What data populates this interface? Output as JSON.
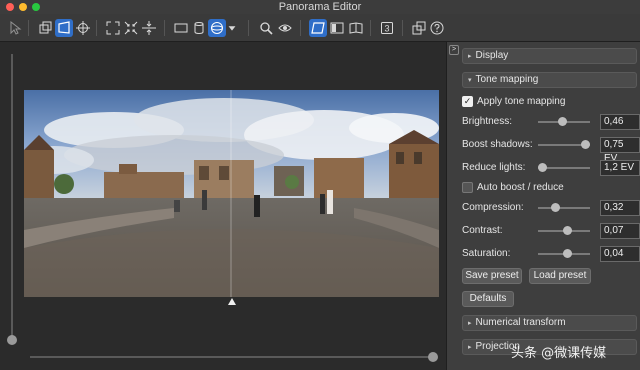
{
  "window": {
    "title": "Panorama Editor"
  },
  "toolbar": {
    "tools": [
      {
        "icon": "pointer-icon",
        "active": false
      },
      {
        "icon": "crop-icon",
        "active": false
      },
      {
        "icon": "projection-icon",
        "active": true
      },
      {
        "icon": "crosshair-icon",
        "active": false
      },
      {
        "icon": "fit-icon",
        "active": false
      },
      {
        "icon": "shrink-icon",
        "active": false
      },
      {
        "icon": "align-icon",
        "active": false
      },
      {
        "icon": "rectangle-icon",
        "active": false
      },
      {
        "icon": "cylinder-icon",
        "active": false
      },
      {
        "icon": "sphere-icon",
        "active": true
      },
      {
        "icon": "dropdown-arrow-icon",
        "active": false
      },
      {
        "icon": "zoom-icon",
        "active": false
      },
      {
        "icon": "eye-icon",
        "active": false
      },
      {
        "icon": "view-flat-icon",
        "active": true
      },
      {
        "icon": "view-tilt-icon",
        "active": false
      },
      {
        "icon": "view-book-icon",
        "active": false
      },
      {
        "icon": "three-icon",
        "active": false,
        "text": "3"
      },
      {
        "icon": "export-icon",
        "active": false
      },
      {
        "icon": "help-icon",
        "active": false
      }
    ]
  },
  "panel": {
    "collapse_glyph": ">",
    "sections": {
      "display": "Display",
      "tone_mapping": "Tone mapping",
      "numerical_transform": "Numerical transform",
      "projection": "Projection"
    },
    "apply_tone_mapping": {
      "label": "Apply tone mapping",
      "checked": true
    },
    "brightness": {
      "label": "Brightness:",
      "value": "0,46",
      "level": 0.45
    },
    "boost_shadows": {
      "label": "Boost shadows:",
      "value": "0,75 EV",
      "level": 0.92
    },
    "reduce_lights": {
      "label": "Reduce lights:",
      "value": "1,2 EV",
      "level": 0.08
    },
    "auto_boost": {
      "label": "Auto boost / reduce",
      "checked": false
    },
    "compression": {
      "label": "Compression:",
      "value": "0,32",
      "level": 0.35
    },
    "contrast": {
      "label": "Contrast:",
      "value": "0,07",
      "level": 0.55
    },
    "saturation": {
      "label": "Saturation:",
      "value": "0,04",
      "level": 0.55
    },
    "buttons": {
      "save_preset": "Save preset",
      "load_preset": "Load preset",
      "defaults": "Defaults"
    }
  },
  "viewport": {
    "vertical_slider_level": 0.0,
    "horizontal_slider_level": 1.0
  },
  "watermark": "头条 @微课传媒"
}
